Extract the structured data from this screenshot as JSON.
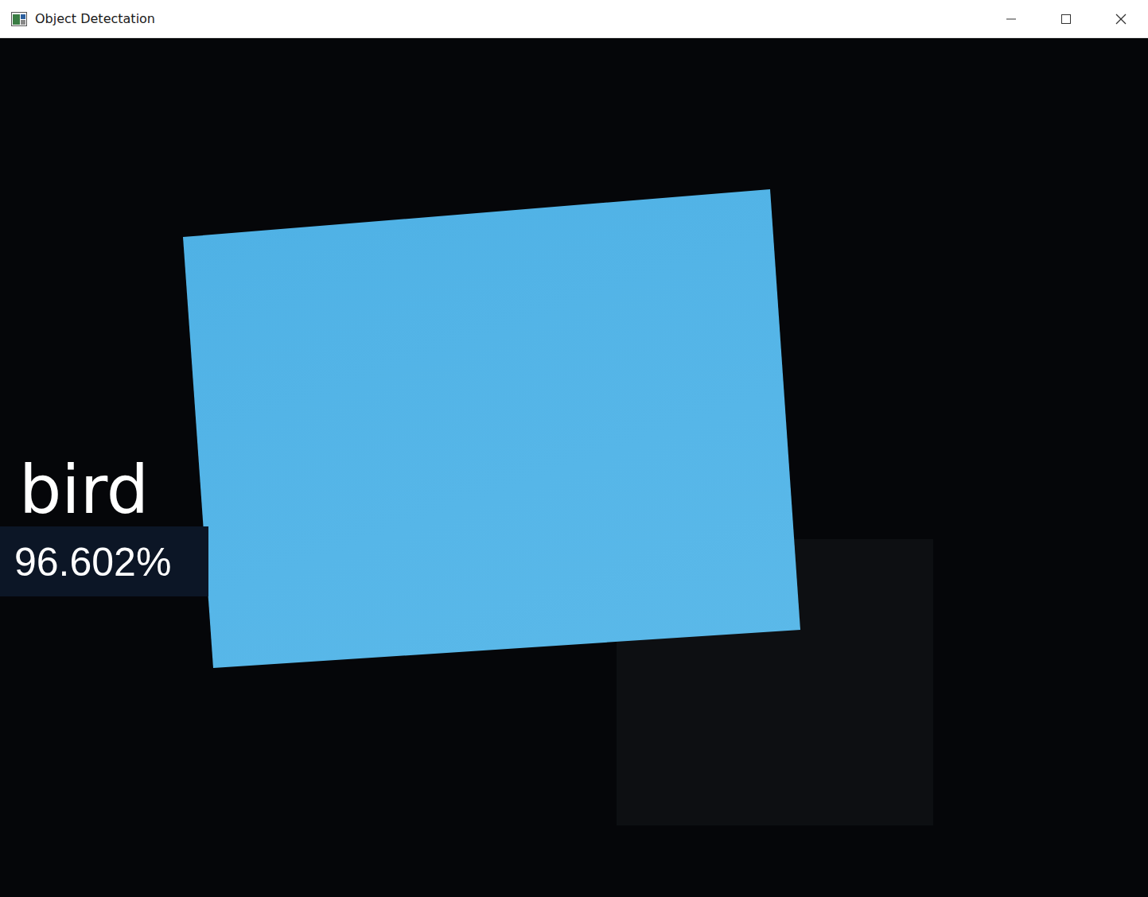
{
  "window": {
    "title": "Object Detectation"
  },
  "detection": {
    "label": "bird",
    "confidence": "96.602%"
  }
}
